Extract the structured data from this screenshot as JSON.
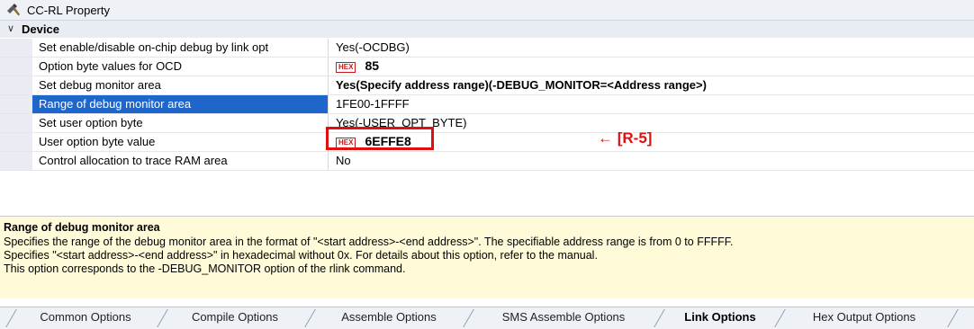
{
  "window": {
    "title": "CC-RL Property"
  },
  "category": {
    "label": "Device"
  },
  "properties": [
    {
      "name": "Set enable/disable on-chip debug by link opt",
      "value": "Yes(-OCDBG)"
    },
    {
      "name": "Option byte values for OCD",
      "value": "85",
      "hex": true
    },
    {
      "name": "Set debug monitor area",
      "value": "Yes(Specify address range)(-DEBUG_MONITOR=<Address range>)"
    },
    {
      "name": "Range of debug monitor area",
      "value": "1FE00-1FFFF"
    },
    {
      "name": "Set user option byte",
      "value": "Yes(-USER_OPT_BYTE)"
    },
    {
      "name": "User option byte value",
      "value": "6EFFE8",
      "hex": true
    },
    {
      "name": "Control allocation to trace RAM area",
      "value": "No"
    }
  ],
  "hex_badge": "HEX",
  "annotation": "← [R-5]",
  "description": {
    "title": "Range of debug monitor area",
    "lines": [
      "Specifies the range of the debug monitor area in the format of \"<start address>-<end address>\". The specifiable address range is from 0 to FFFFF.",
      "Specifies \"<start address>-<end address>\" in hexadecimal without 0x. For details about this option, refer to the manual.",
      "This option corresponds to the -DEBUG_MONITOR option of the rlink command."
    ]
  },
  "tabs": [
    {
      "label": "Common Options"
    },
    {
      "label": "Compile Options"
    },
    {
      "label": "Assemble Options"
    },
    {
      "label": "SMS Assemble Options"
    },
    {
      "label": "Link Options"
    },
    {
      "label": "Hex Output Options"
    }
  ],
  "colors": {
    "selection": "#1e66c9",
    "annotation_red": "#e01010",
    "description_bg": "#fffbd8"
  }
}
